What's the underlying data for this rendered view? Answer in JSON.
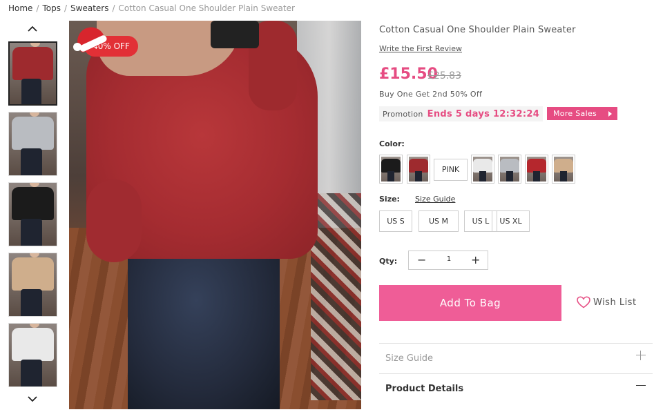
{
  "breadcrumb": {
    "items": [
      "Home",
      "Tops",
      "Sweaters"
    ],
    "current": "Cotton Casual One Shoulder Plain Sweater",
    "separator": "/"
  },
  "gallery": {
    "badge": "40% OFF",
    "thumbnail_colors": [
      "#9e2a2e",
      "#b9bcc1",
      "#1b1b1b",
      "#cfae8c",
      "#e9e9e9"
    ],
    "active_index": 0
  },
  "product": {
    "title": "Cotton Casual One Shoulder Plain Sweater",
    "review_link": "Write the First Review",
    "price": "£15.50",
    "old_price": "£25.83",
    "offer": "Buy One Get 2nd 50% Off",
    "promotion_label": "Promotion",
    "promotion_countdown": "Ends 5 days 12:32:24",
    "more_sales": "More Sales"
  },
  "color": {
    "label": "Color:",
    "text_option": "PINK",
    "swatch_colors": [
      "#1b1b1b",
      "#9e2a2e",
      "#e9e9e9",
      "#b9bcc1",
      "#b5272d",
      "#cfae8c"
    ]
  },
  "size": {
    "label": "Size:",
    "guide_link": "Size Guide",
    "options": [
      "US S",
      "US M",
      "US L",
      "US XL"
    ]
  },
  "quantity": {
    "label": "Qty:",
    "value": "1",
    "minus": "−",
    "plus": "+"
  },
  "actions": {
    "add_to_bag": "Add To Bag",
    "wish_list": "Wish List"
  },
  "accordion": [
    {
      "title": "Size Guide",
      "expanded": false,
      "color": "#999999"
    },
    {
      "title": "Product Details",
      "expanded": true,
      "color": "#333333"
    }
  ],
  "colors": {
    "accent": "#e64c82",
    "button": "#ef5d97",
    "badge": "#e23036"
  }
}
